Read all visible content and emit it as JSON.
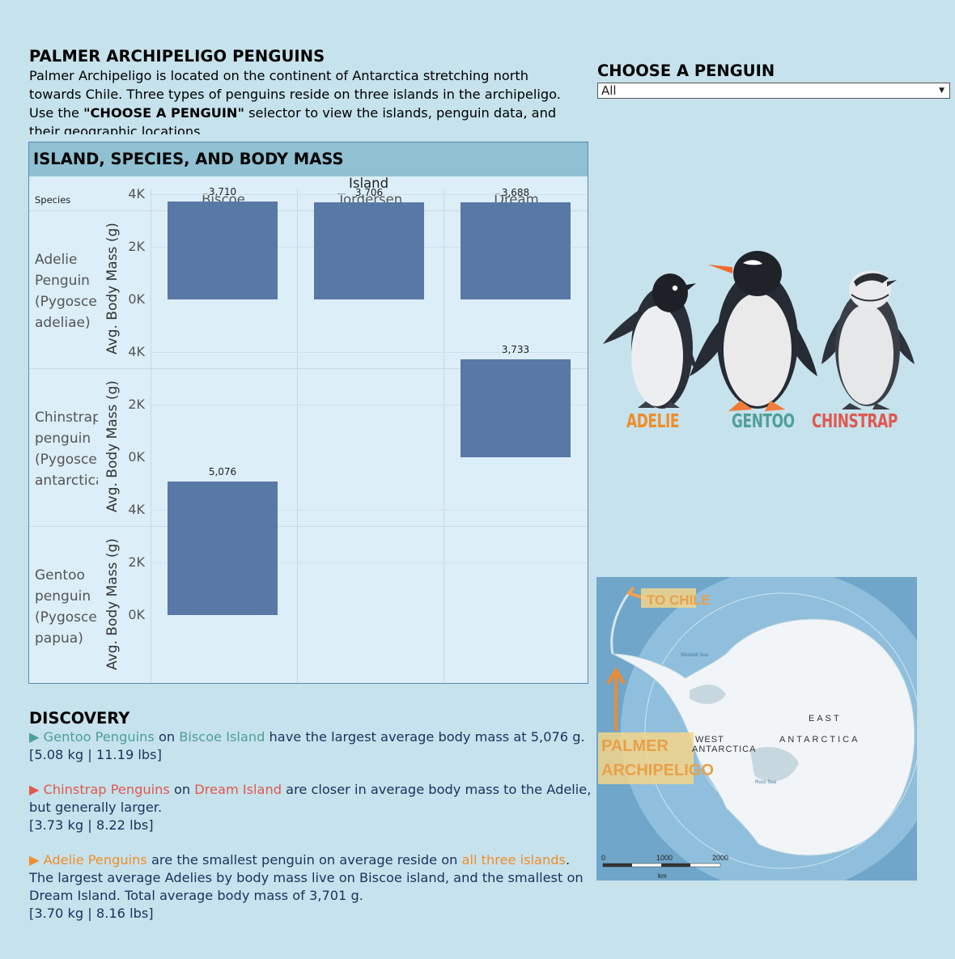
{
  "header": {
    "title": "PALMER ARCHIPELIGO PENGUINS",
    "intro_line1": "Palmer Archipeligo is located on the continent of Antarctica stretching north",
    "intro_line2": "towards Chile. Three types of penguins reside on three islands in the archipeligo.",
    "intro_line3_pre": "Use the ",
    "intro_line3_bold": "\"CHOOSE A PENGUIN\"",
    "intro_line3_post": " selector to view the islands, penguin data, and",
    "intro_line4": "their geographic locations."
  },
  "filter": {
    "title": "CHOOSE A PENGUIN",
    "selected": "All"
  },
  "chart": {
    "panel_title": "ISLAND, SPECIES, AND BODY MASS",
    "row_header": "Species",
    "column_header": "Island",
    "y_axis_title": "Avg. Body Mass (g)",
    "y_ticks": [
      "4K",
      "2K",
      "0K"
    ],
    "species_labels": [
      [
        "Adelie",
        "Penguin",
        "(Pygoscelis",
        "adeliae)"
      ],
      [
        "Chinstrap",
        "penguin",
        "(Pygoscelis",
        "antarctica)"
      ],
      [
        "Gentoo",
        "penguin",
        "(Pygoscelis",
        "papua)"
      ]
    ]
  },
  "chart_data": {
    "type": "bar",
    "title": "ISLAND, SPECIES, AND BODY MASS",
    "categories": [
      "Biscoe",
      "Torgersen",
      "Dream"
    ],
    "ylabel": "Avg. Body Mass (g)",
    "ylim": [
      0,
      5500
    ],
    "series": [
      {
        "name": "Adelie Penguin (Pygoscelis adeliae)",
        "values": [
          3710,
          3706,
          3688
        ],
        "labels": [
          "3,710",
          "3,706",
          "3,688"
        ]
      },
      {
        "name": "Chinstrap penguin (Pygoscelis antarctica)",
        "values": [
          null,
          null,
          3733
        ],
        "labels": [
          "",
          "",
          "3,733"
        ]
      },
      {
        "name": "Gentoo penguin (Pygoscelis papua)",
        "values": [
          5076,
          null,
          null
        ],
        "labels": [
          "5,076",
          "",
          ""
        ]
      }
    ],
    "colors": {
      "bar": "#5878a6"
    },
    "grid": true
  },
  "illustration": {
    "labels": [
      "ADELIE",
      "GENTOO",
      "CHINSTRAP"
    ],
    "colors": [
      "#ee8e2a",
      "#4f9f99",
      "#e0584f"
    ]
  },
  "map": {
    "to_chile": "TO CHILE",
    "palmer": "PALMER",
    "archipeligo": "ARCHIPELIGO",
    "west": "WEST",
    "antarctica_w": "ANTARCTICA",
    "east": "EAST",
    "antarctica_e": "ANTARCTICA",
    "scale_0": "0",
    "scale_1000": "1000",
    "scale_2000": "2000",
    "scale_unit": "km",
    "weddell": "Weddell Sea",
    "ross": "Ross Sea"
  },
  "discovery": {
    "title": "DISCOVERY",
    "p1_marker": "▶",
    "p1_species": " Gentoo Penguins",
    "p1_on": " on ",
    "p1_island": "Biscoe Island",
    "p1_rest": " have the largest average body mass at 5,076 g.",
    "p1_units": "[5.08 kg | 11.19 lbs]",
    "p2_marker": "▶",
    "p2_species": " Chinstrap Penguins",
    "p2_on": " on ",
    "p2_island": "Dream Island",
    "p2_rest": " are closer in average body mass to the Adelie, but generally larger.",
    "p2_units": "[3.73 kg | 8.22 lbs]",
    "p3_marker": "▶",
    "p3_species": " Adelie Penguins",
    "p3_mid": " are the smallest penguin on average reside on ",
    "p3_island": "all three islands",
    "p3_rest": ". The largest average Adelies by body mass live on Biscoe island, and the smallest on Dream Island. Total average body mass of 3,701 g.",
    "p3_units": "[3.70 kg | 8.16 lbs]"
  }
}
